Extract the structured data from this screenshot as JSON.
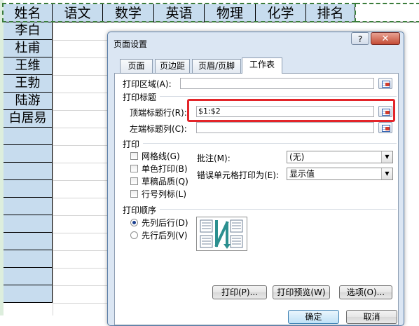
{
  "sheet": {
    "headers": [
      "姓名",
      "语文",
      "数学",
      "英语",
      "物理",
      "化学",
      "排名"
    ],
    "names": [
      "李白",
      "杜甫",
      "王维",
      "王勃",
      "陆游",
      "白居易"
    ]
  },
  "dialog": {
    "title": "页面设置",
    "help": "?",
    "close": "✕",
    "tabs": [
      "页面",
      "页边距",
      "页眉/页脚",
      "工作表"
    ],
    "print_area_label": "打印区域(A):",
    "print_titles_label": "打印标题",
    "rows_to_repeat_label": "顶端标题行(R):",
    "rows_to_repeat_value": "$1:$2",
    "cols_to_repeat_label": "左端标题列(C):",
    "print_section_label": "打印",
    "checkboxes": [
      "网格线(G)",
      "单色打印(B)",
      "草稿品质(Q)",
      "行号列标(L)"
    ],
    "comments_label": "批注(M):",
    "comments_value": "(无)",
    "errors_label": "错误单元格打印为(E):",
    "errors_value": "显示值",
    "page_order_label": "打印顺序",
    "order_options": [
      "先列后行(D)",
      "先行后列(V)"
    ],
    "buttons": {
      "print": "打印(P)...",
      "preview": "打印预览(W)",
      "options": "选项(O)..."
    },
    "ok_label": "确定",
    "cancel_label": "取消"
  },
  "colors": {
    "header_fill": "#c7dcee",
    "highlight_red": "#e3252a"
  }
}
